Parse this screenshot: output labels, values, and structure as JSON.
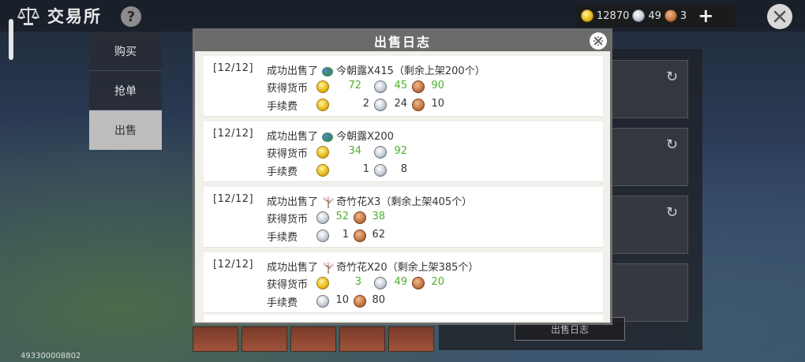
{
  "header": {
    "title": "交易所",
    "help": "?"
  },
  "currency": {
    "gold": "12870",
    "silver": "49",
    "copper": "3",
    "add": "+"
  },
  "nav": {
    "items": [
      "购买",
      "抢单",
      "出售"
    ],
    "active": 2
  },
  "right_panel": {
    "sell_log_button": "出售日志"
  },
  "build_id": "493300008802",
  "modal": {
    "title": "出售日志",
    "entries": [
      {
        "date": "[12/12]",
        "action": "成功出售了",
        "item": "今朝露X415（剩余上架200个）",
        "item_icon": "flower-bud-icon",
        "earned_label": "获得货币",
        "fee_label": "手续费",
        "earned": [
          {
            "coin": "gold",
            "value": "72"
          },
          {
            "coin": "silver",
            "value": "45"
          },
          {
            "coin": "copper",
            "value": "90"
          }
        ],
        "fee": [
          {
            "coin": "gold",
            "value": "2"
          },
          {
            "coin": "silver",
            "value": "24"
          },
          {
            "coin": "copper",
            "value": "10"
          }
        ]
      },
      {
        "date": "[12/12]",
        "action": "成功出售了",
        "item": "今朝露X200",
        "item_icon": "flower-bud-icon",
        "earned_label": "获得货币",
        "fee_label": "手续费",
        "earned": [
          {
            "coin": "gold",
            "value": "34"
          },
          {
            "coin": "silver",
            "value": "92"
          }
        ],
        "fee": [
          {
            "coin": "gold",
            "value": "1"
          },
          {
            "coin": "silver",
            "value": "8"
          }
        ]
      },
      {
        "date": "[12/12]",
        "action": "成功出售了",
        "item": "奇竹花X3（剩余上架405个）",
        "item_icon": "bamboo-flower-icon",
        "earned_label": "获得货币",
        "fee_label": "手续费",
        "earned": [
          {
            "coin": "silver",
            "value": "52"
          },
          {
            "coin": "copper",
            "value": "38"
          }
        ],
        "fee": [
          {
            "coin": "silver",
            "value": "1"
          },
          {
            "coin": "copper",
            "value": "62"
          }
        ]
      },
      {
        "date": "[12/12]",
        "action": "成功出售了",
        "item": "奇竹花X20（剩余上架385个）",
        "item_icon": "bamboo-flower-icon",
        "earned_label": "获得货币",
        "fee_label": "手续费",
        "earned": [
          {
            "coin": "gold",
            "value": "3"
          },
          {
            "coin": "silver",
            "value": "49"
          },
          {
            "coin": "copper",
            "value": "20"
          }
        ],
        "fee": [
          {
            "coin": "silver",
            "value": "10"
          },
          {
            "coin": "copper",
            "value": "80"
          }
        ]
      }
    ]
  },
  "colors": {
    "earned_value": "#4fae2e",
    "modal_header": "#6b6b6b",
    "gold": "#e8bd1e",
    "silver": "#c8ced6",
    "copper": "#c77a46"
  }
}
